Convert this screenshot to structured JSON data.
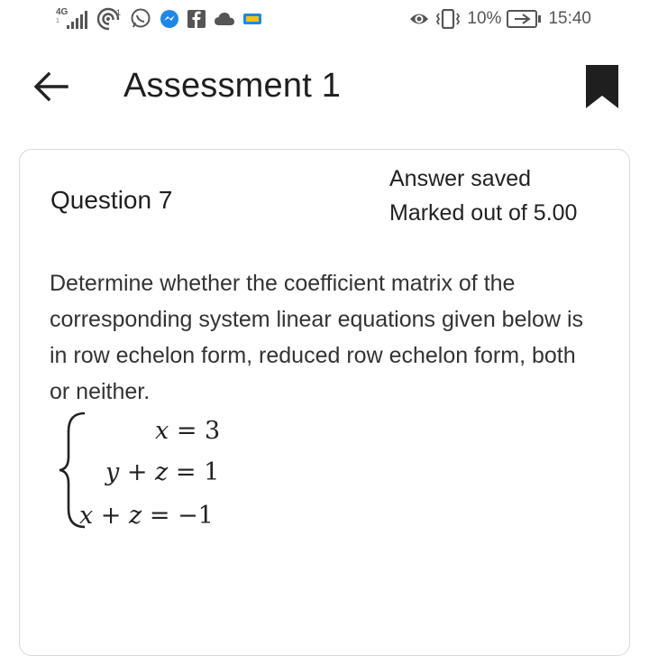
{
  "status_bar": {
    "network_type": "4G",
    "network_sub": "1",
    "signal_icon": "signal-bars-icon",
    "left_icons": [
      "hotspot-icon",
      "whatsapp-icon",
      "messenger-icon",
      "facebook-icon",
      "cloud-icon",
      "app-icon"
    ],
    "right_icons": [
      "eye-icon",
      "vibrate-icon",
      "battery-icon"
    ],
    "battery_percent": "10%",
    "time": "15:40"
  },
  "app_bar": {
    "back_icon": "back-arrow-icon",
    "title": "Assessment 1",
    "bookmark_icon": "bookmark-icon"
  },
  "question": {
    "number_label": "Question 7",
    "status": "Answer saved",
    "mark": "Marked out of 5.00",
    "text": "Determine whether the coefficient matrix of the corresponding system linear equations given below is in row echelon form, reduced row echelon form, both or neither.",
    "equations": [
      {
        "lhs": "x",
        "rhs": "3"
      },
      {
        "lhs": "y + z",
        "rhs": "1"
      },
      {
        "lhs": "x + z",
        "rhs": "−1"
      }
    ]
  }
}
